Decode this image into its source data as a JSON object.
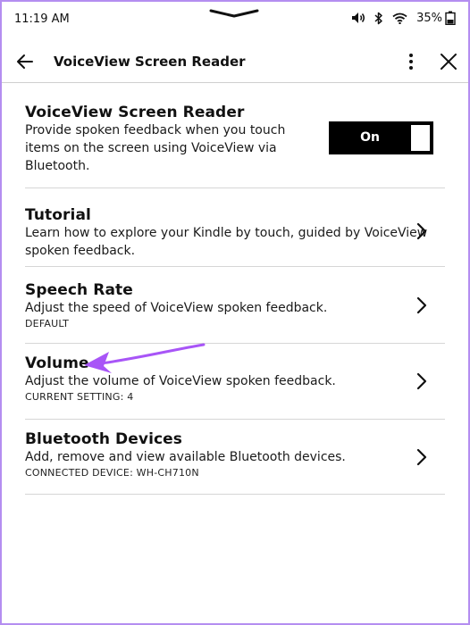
{
  "status_bar": {
    "time": "11:19 AM",
    "battery": "35%"
  },
  "header": {
    "title": "VoiceView Screen Reader"
  },
  "items": [
    {
      "title": "VoiceView Screen Reader",
      "description": "Provide spoken feedback when you touch items on the screen using VoiceView via Bluetooth.",
      "toggle": "On"
    },
    {
      "title": "Tutorial",
      "description": "Learn how to explore your Kindle by touch, guided by VoiceView spoken feedback."
    },
    {
      "title": "Speech Rate",
      "description": "Adjust the speed of VoiceView spoken feedback.",
      "sub": "DEFAULT"
    },
    {
      "title": "Volume",
      "description": "Adjust the volume of VoiceView spoken feedback.",
      "sub": "CURRENT SETTING: 4"
    },
    {
      "title": "Bluetooth Devices",
      "description": "Add, remove and view available Bluetooth devices.",
      "sub": "CONNECTED DEVICE: WH-CH710N"
    }
  ],
  "colors": {
    "frame": "#b48ef0",
    "annotation_arrow": "#a855f7",
    "toggle_bg": "#000000"
  }
}
